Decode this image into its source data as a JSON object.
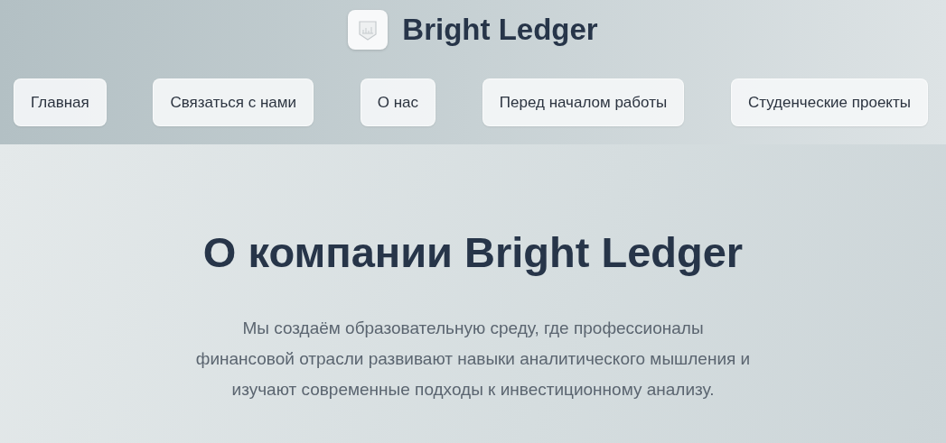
{
  "brand": {
    "name": "Bright Ledger"
  },
  "nav": [
    {
      "label": "Главная"
    },
    {
      "label": "Связаться с нами"
    },
    {
      "label": "О нас"
    },
    {
      "label": "Перед началом работы"
    },
    {
      "label": "Студенческие проекты"
    }
  ],
  "hero": {
    "title": "О компании Bright Ledger",
    "text": "Мы создаём образовательную среду, где профессионалы финансовой отрасли развивают навыки аналитического мышления и изучают современные подходы к инвестиционному анализу."
  }
}
